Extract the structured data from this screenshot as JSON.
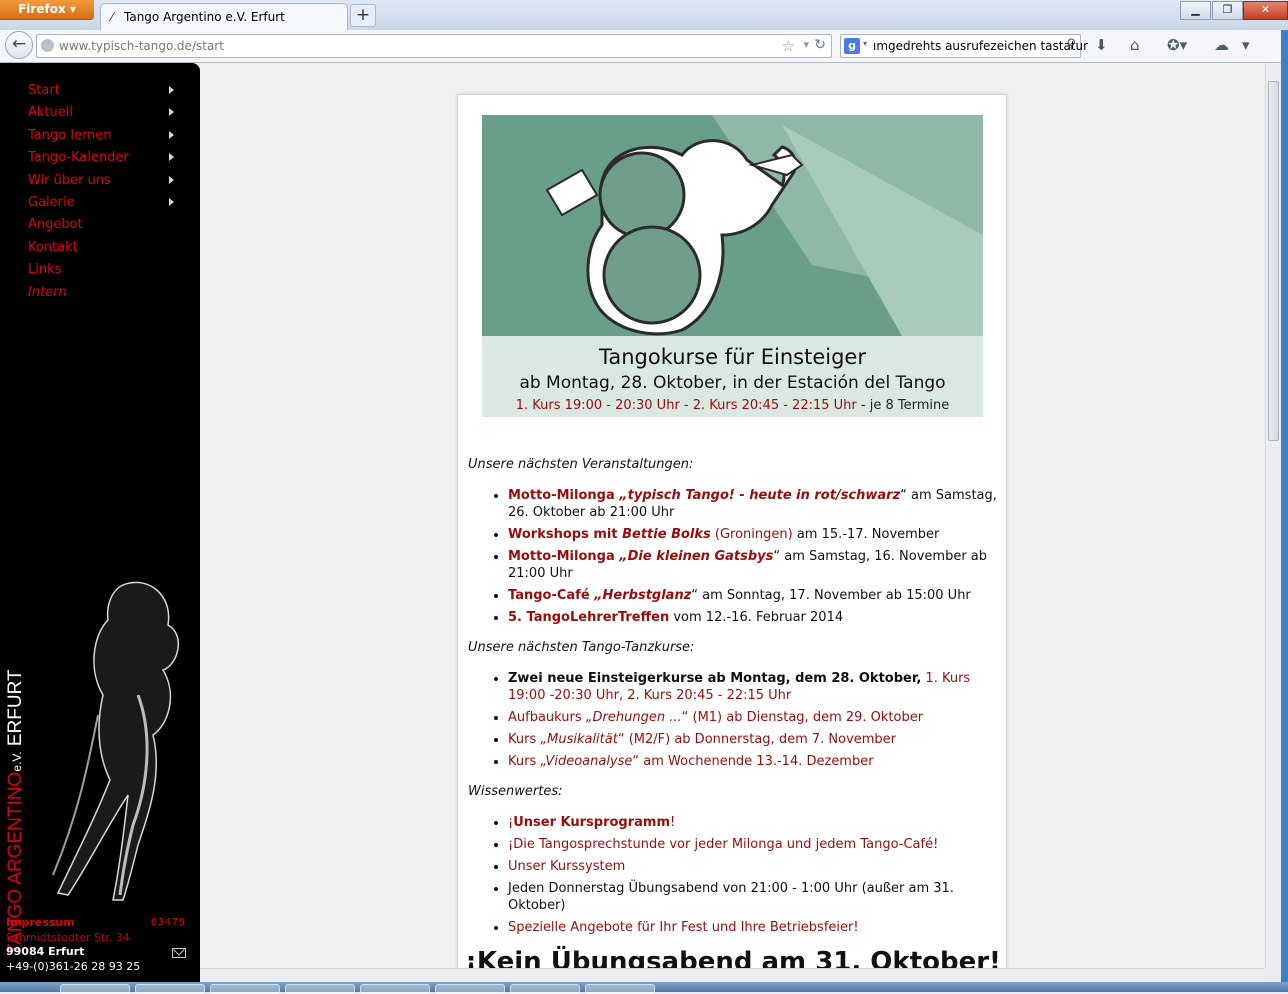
{
  "browser": {
    "app_button": "Firefox",
    "tab_title": "Tango Argentino e.V. Erfurt",
    "url_host": "www.typisch-tango.de",
    "url_path": "/start",
    "search_text": "ımgedrehts ausrufezeichen tastatur",
    "new_tab_label": "+"
  },
  "sidebar": {
    "menu": [
      {
        "label": "Start"
      },
      {
        "label": "Aktuell"
      },
      {
        "label": "Tango lernen"
      },
      {
        "label": "Tango-Kalender"
      },
      {
        "label": "Wir über uns"
      },
      {
        "label": "Galerie"
      },
      {
        "label": "Angebot"
      },
      {
        "label": "Kontakt"
      },
      {
        "label": "Links"
      },
      {
        "label": "Intern"
      }
    ],
    "brand": {
      "part1": "TANGO ARGENTINO",
      "part2": "e.V.",
      "part3": "ERFURT"
    },
    "footer": {
      "impressum": "Impressum",
      "counter": "83479",
      "street": "Schmidtstedter Str. 34",
      "city": "99084 Erfurt",
      "phone": "+49-(0)361-26 28 93 25"
    }
  },
  "banner": {
    "title": "Tangokurse für Einsteiger",
    "subtitle": "ab Montag, 28. Oktober, in der Estación del Tango",
    "times": "1. Kurs 19:00 - 20:30 Uhr - 2. Kurs 20:45 - 22:15 Uhr",
    "times_suffix": "- je 8 Termine"
  },
  "sections": {
    "events_heading": "Unsere nächsten Veranstaltungen:",
    "events": {
      "e1a": "Motto-Milonga ",
      "e1b": "„typisch Tango! - heute in rot/schwarz",
      "e1c": "“ am Samstag, 26. Oktober ab 21:00 Uhr",
      "e2a": "Workshops mit ",
      "e2b": "Bettie Bolks",
      "e2c": " (Groningen)",
      "e2d": " am 15.-17. November",
      "e3a": "Motto-Milonga ",
      "e3b": "„Die kleinen Gatsbys",
      "e3c": "“ am Samstag, 16. November ab 21:00 Uhr",
      "e4a": "Tango-Café ",
      "e4b": "„Herbstglanz",
      "e4c": "“ am Sonntag, 17. November ab 15:00 Uhr",
      "e5a": "5. TangoLehrerTreffen",
      "e5b": " vom 12.-16. Februar 2014"
    },
    "courses_heading": "Unsere nächsten Tango-Tanzkurse:",
    "courses": {
      "c1a": "Zwei neue Einsteigerkurse ab Montag, dem 28. Oktober,",
      "c1b": " 1. Kurs 19:00 -20:30 Uhr, 2. Kurs 20:45 - 22:15 Uhr",
      "c2a": "Aufbaukurs ",
      "c2b": "„Drehungen ...",
      "c2c": "“ (M1) ab Dienstag, dem 29. Oktober",
      "c3a": "Kurs ",
      "c3b": "„Musikalität",
      "c3c": "“ (M2/F) ab Donnerstag, dem 7. November",
      "c4a": "Kurs ",
      "c4b": "„Videoanalyse",
      "c4c": "“ am Wochenende 13.-14. Dezember"
    },
    "facts_heading": "Wissenwertes:",
    "facts": {
      "f1a": "¡",
      "f1b": "Unser Kursprogramm",
      "f1c": "!",
      "f2": "¡Die Tangosprechstunde vor jeder Milonga und jedem Tango-Café!",
      "f3": "Unser Kurssystem",
      "f4": "Jeden Donnerstag Übungsabend von 21:00 - 1:00 Uhr (außer am 31. Oktober)",
      "f5": "Spezielle Angebote für Ihr Fest und Ihre Betriebsfeier!"
    },
    "big_heading": "¡Kein Übungsabend am 31. Oktober!"
  }
}
